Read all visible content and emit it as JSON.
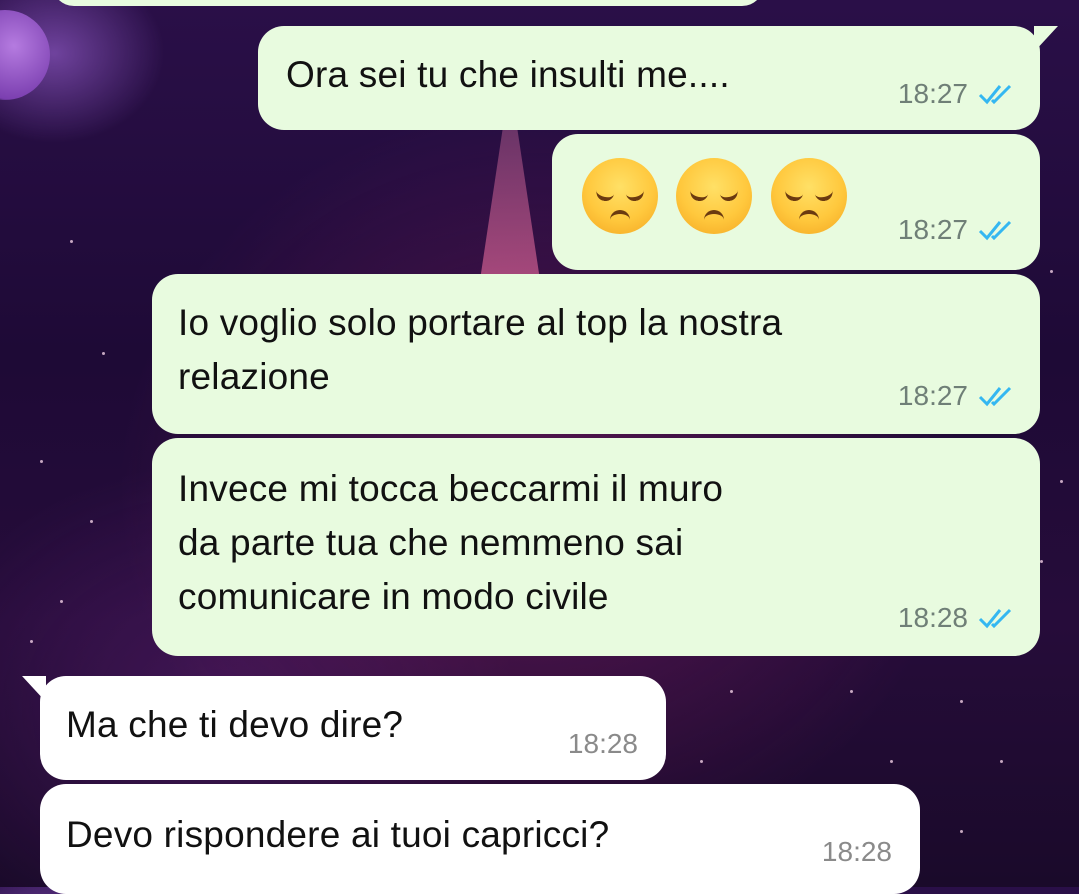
{
  "messages": [
    {
      "text": "Ora sei tu che insulti me....",
      "time": "18:27",
      "status": "read"
    },
    {
      "emojis": [
        "disappointed-face",
        "disappointed-face",
        "disappointed-face"
      ],
      "time": "18:27",
      "status": "read"
    },
    {
      "lines": [
        "Io voglio solo portare al top la nostra",
        "relazione"
      ],
      "time": "18:27",
      "status": "read"
    },
    {
      "lines": [
        "Invece mi tocca beccarmi il muro",
        "da parte tua che nemmeno sai",
        "comunicare in modo civile"
      ],
      "time": "18:28",
      "status": "read"
    },
    {
      "text": "Ma che ti devo dire?",
      "time": "18:28"
    },
    {
      "text": "Devo rispondere ai tuoi capricci?",
      "time": "18:28"
    }
  ],
  "colors": {
    "outgoing_bubble": "#e8fbdf",
    "incoming_bubble": "#ffffff",
    "read_check": "#34b7f1"
  }
}
